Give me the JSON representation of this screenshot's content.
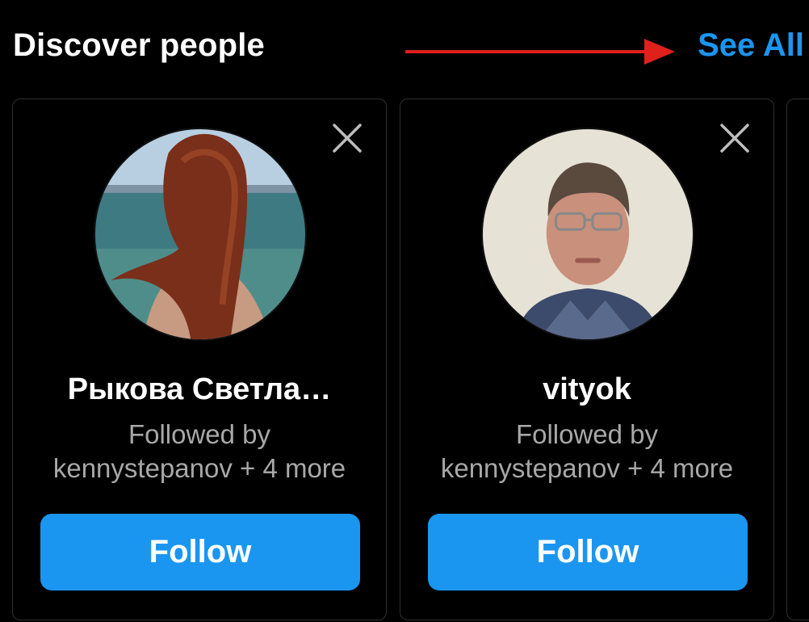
{
  "header": {
    "title": "Discover people",
    "see_all_label": "See All"
  },
  "colors": {
    "accent": "#1a96f0",
    "annotation_arrow": "#e0201b"
  },
  "suggestions": [
    {
      "name": "Рыкова Светла…",
      "followed_by_line1": "Followed by",
      "followed_by_line2": "kennystepanov + 4 more",
      "follow_label": "Follow",
      "dismiss_icon": "close-icon"
    },
    {
      "name": "vityok",
      "followed_by_line1": "Followed by",
      "followed_by_line2": "kennystepanov + 4 more",
      "follow_label": "Follow",
      "dismiss_icon": "close-icon"
    }
  ]
}
